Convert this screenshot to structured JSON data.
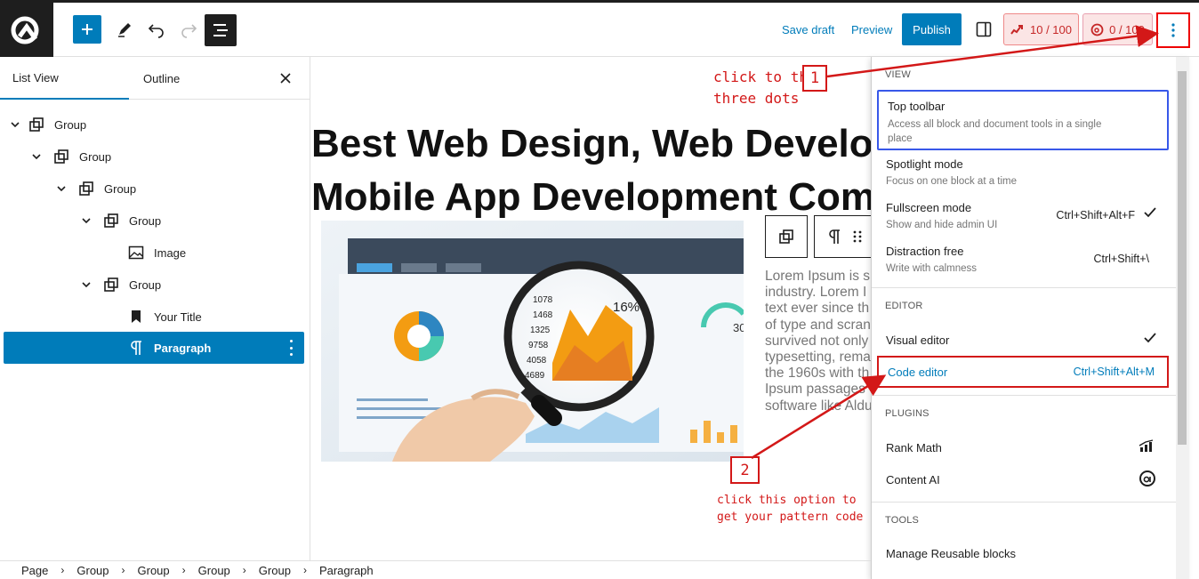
{
  "toolbar": {
    "save_draft": "Save draft",
    "preview": "Preview",
    "publish": "Publish",
    "rank_math_score": "10 / 100",
    "content_ai_score": "0 / 100"
  },
  "sidebar": {
    "tab_list_view": "List View",
    "tab_outline": "Outline",
    "tree": [
      {
        "label": "Group",
        "icon": "group-icon",
        "chevron": true
      },
      {
        "label": "Group",
        "icon": "group-icon",
        "chevron": true
      },
      {
        "label": "Group",
        "icon": "group-icon",
        "chevron": true
      },
      {
        "label": "Group",
        "icon": "group-icon",
        "chevron": true
      },
      {
        "label": "Image",
        "icon": "image-icon",
        "chevron": false
      },
      {
        "label": "Group",
        "icon": "group-icon",
        "chevron": true
      },
      {
        "label": "Your Title",
        "icon": "bookmark-icon",
        "chevron": false
      },
      {
        "label": "Paragraph",
        "icon": "paragraph-icon",
        "chevron": false,
        "selected": true
      }
    ]
  },
  "canvas": {
    "headline_line1": "Best Web Design, Web Develo",
    "headline_line2": "Mobile App Development Com",
    "paragraph": "Lorem Ipsum is s\nindustry. Lorem I\ntext ever since th\nof type and scran\nsurvived not only\ntypesetting, rema\nthe 1960s with th\nIpsum passages\nsoftware like Aldu",
    "image_numbers": [
      "1078",
      "1468",
      "1325",
      "9758",
      "4058",
      "4689"
    ],
    "image_big_number": "16%",
    "image_gauge_number": "30"
  },
  "annotations": {
    "step1_number": "1",
    "step1_text_line1": "click to this",
    "step1_text_line2": "three dots",
    "step2_number": "2",
    "step2_text_line1": "click this option to",
    "step2_text_line2": "get your pattern code"
  },
  "menu": {
    "view_heading": "VIEW",
    "top_toolbar": {
      "label": "Top toolbar",
      "desc": "Access all block and document tools in a single place"
    },
    "spotlight": {
      "label": "Spotlight mode",
      "desc": "Focus on one block at a time"
    },
    "fullscreen": {
      "label": "Fullscreen mode",
      "desc": "Show and hide admin UI",
      "shortcut": "Ctrl+Shift+Alt+F",
      "checked": true
    },
    "distraction": {
      "label": "Distraction free",
      "desc": "Write with calmness",
      "shortcut": "Ctrl+Shift+\\"
    },
    "editor_heading": "EDITOR",
    "visual_editor": {
      "label": "Visual editor",
      "checked": true
    },
    "code_editor": {
      "label": "Code editor",
      "shortcut": "Ctrl+Shift+Alt+M"
    },
    "plugins_heading": "PLUGINS",
    "rank_math": {
      "label": "Rank Math",
      "icon": "rank-math-icon"
    },
    "content_ai": {
      "label": "Content AI",
      "icon": "content-ai-icon"
    },
    "tools_heading": "TOOLS",
    "reusable_blocks": {
      "label": "Manage Reusable blocks"
    }
  },
  "breadcrumb": [
    "Page",
    "Group",
    "Group",
    "Group",
    "Group",
    "Paragraph"
  ],
  "colors": {
    "accent": "#007cba",
    "annotation": "#d31818",
    "dark": "#1e1e1e"
  }
}
